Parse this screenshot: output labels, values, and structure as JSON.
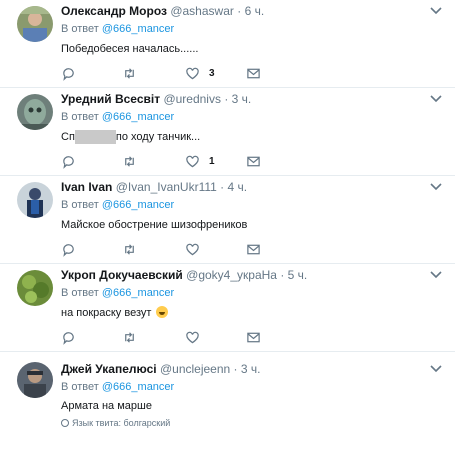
{
  "reply_prefix": "В ответ",
  "tweets": [
    {
      "name": "Олександр Мороз",
      "handle": "@ashaswar",
      "time": "6 ч.",
      "reply_to": "@666_mancer",
      "text": "Победобесея началась......",
      "replies": "",
      "retweets": "",
      "likes": "3",
      "avatar_icon": "avatar-photo"
    },
    {
      "name": "Уредний Всесвіт",
      "handle": "@urednivs",
      "time": "3 ч.",
      "reply_to": "@666_mancer",
      "text_start": "Сп",
      "text_end": "по ходу танчик...",
      "replies": "",
      "retweets": "",
      "likes": "1",
      "avatar_icon": "avatar-photo"
    },
    {
      "name": "Ivan Ivan",
      "handle": "@Ivan_IvanUkr111",
      "time": "4 ч.",
      "reply_to": "@666_mancer",
      "text": "Майское обострение шизофреников",
      "replies": "",
      "retweets": "",
      "likes": "",
      "avatar_icon": "avatar-photo"
    },
    {
      "name": "Укроп Докучаевский",
      "handle": "@goky4_укpаHa",
      "time": "5 ч.",
      "reply_to": "@666_mancer",
      "text": "на покраску везут",
      "emoji": "grinning-face-emoji",
      "replies": "",
      "retweets": "",
      "likes": "",
      "avatar_icon": "avatar-photo"
    },
    {
      "name": "Джей Укапелюсі",
      "handle": "@unclejeenn",
      "time": "3 ч.",
      "reply_to": "@666_mancer",
      "text": "Армата на марше",
      "language_note": "Язык твита: болгарский",
      "avatar_icon": "avatar-photo"
    }
  ],
  "colors": {
    "link": "#1b95e0",
    "secondary": "#657786",
    "border": "#e6ecf0"
  },
  "icons": [
    "reply-icon",
    "retweet-icon",
    "like-icon",
    "message-icon",
    "chevron-down-icon",
    "globe-icon"
  ]
}
